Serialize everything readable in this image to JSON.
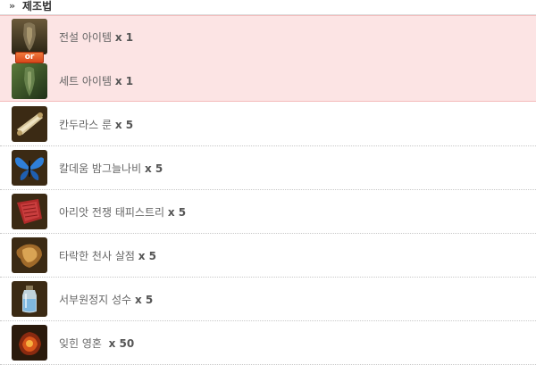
{
  "section": {
    "arrow": "»",
    "title": "제조법"
  },
  "or_label": "or",
  "items": [
    {
      "name": "전설 아이템",
      "qty": "x 1",
      "icon": "legendary-item-icon"
    },
    {
      "name": "세트 아이템",
      "qty": "x 1",
      "icon": "set-item-icon"
    },
    {
      "name": "칸두라스 룬",
      "qty": "x 5",
      "icon": "rune-scroll-icon"
    },
    {
      "name": "칼데움 밤그늘나비",
      "qty": "x 5",
      "icon": "blue-butterfly-icon"
    },
    {
      "name": "아리앗 전쟁 태피스트리",
      "qty": "x 5",
      "icon": "tapestry-icon"
    },
    {
      "name": "타락한 천사 살점",
      "qty": "x 5",
      "icon": "angel-flesh-icon"
    },
    {
      "name": "서부원정지 성수",
      "qty": "x 5",
      "icon": "holy-water-icon"
    },
    {
      "name": "잊힌 영혼 ",
      "qty": "x 50",
      "icon": "forgotten-soul-icon"
    }
  ],
  "colors": {
    "choice_background": "#fce4e4",
    "badge": "#e0561f",
    "label_text": "#666666"
  }
}
